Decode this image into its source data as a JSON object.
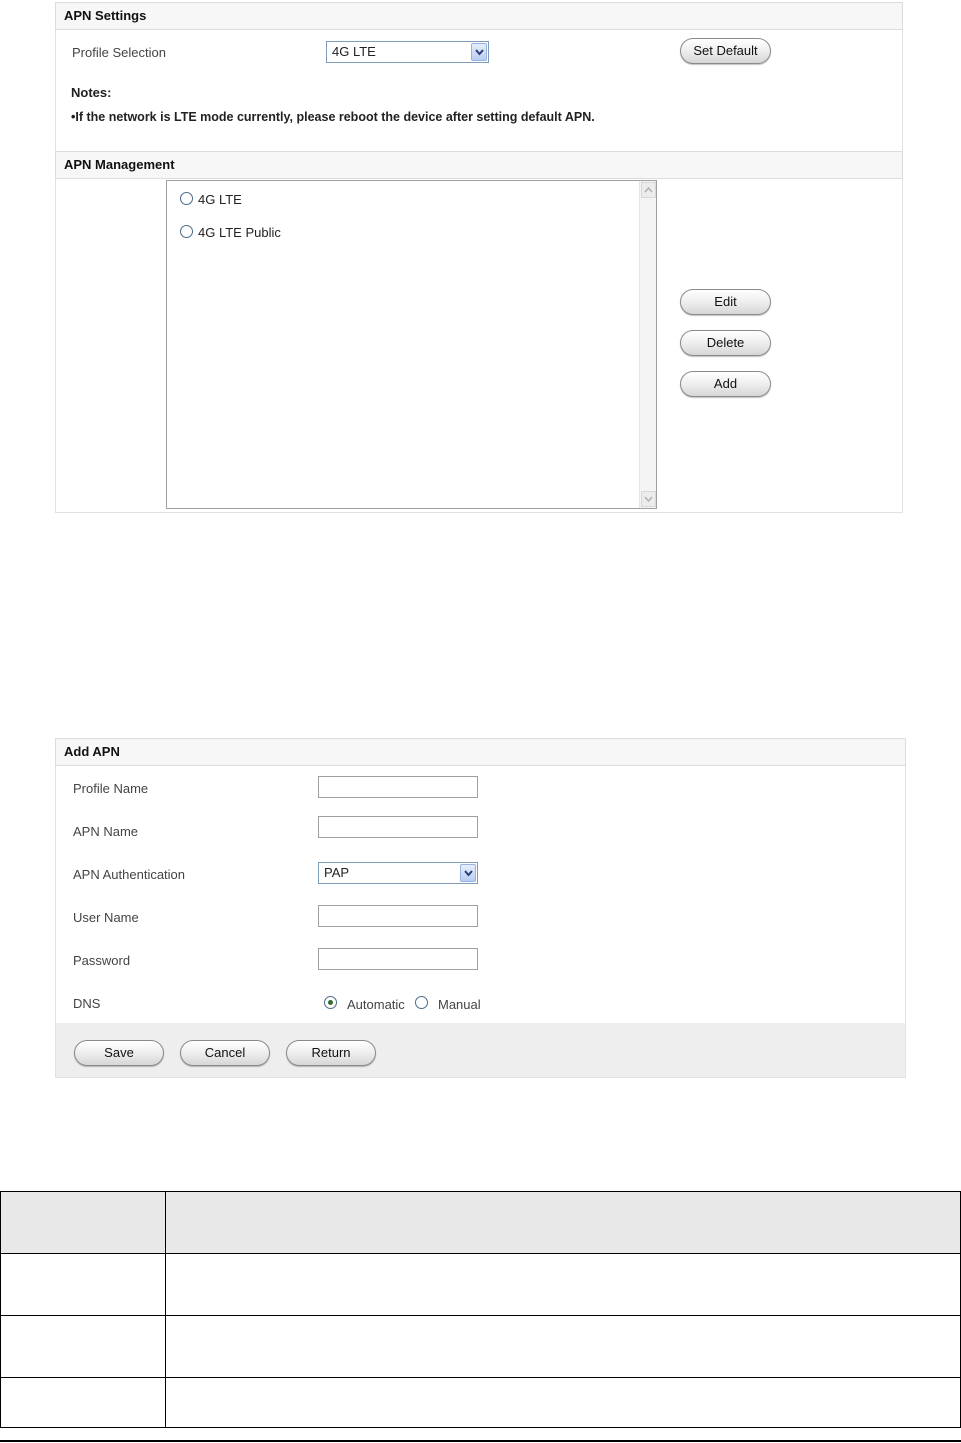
{
  "apn_settings": {
    "header": "APN Settings",
    "profile_selection_label": "Profile Selection",
    "profile_selection_value": "4G LTE",
    "set_default_label": "Set Default",
    "notes_title": "Notes:",
    "notes_text": "•If the network is LTE mode currently, please reboot the device after setting default APN."
  },
  "apn_management": {
    "header": "APN Management",
    "profiles": [
      {
        "label": "4G LTE",
        "checked": false
      },
      {
        "label": "4G LTE Public",
        "checked": false
      }
    ],
    "edit_label": "Edit",
    "delete_label": "Delete",
    "add_label": "Add"
  },
  "add_apn": {
    "header": "Add APN",
    "profile_name_label": "Profile Name",
    "profile_name_value": "",
    "apn_name_label": "APN Name",
    "apn_name_value": "",
    "apn_auth_label": "APN Authentication",
    "apn_auth_value": "PAP",
    "user_name_label": "User Name",
    "user_name_value": "",
    "password_label": "Password",
    "password_value": "",
    "dns_label": "DNS",
    "dns_options": [
      {
        "label": "Automatic",
        "checked": true
      },
      {
        "label": "Manual",
        "checked": false
      }
    ],
    "save_label": "Save",
    "cancel_label": "Cancel",
    "return_label": "Return"
  },
  "colors": {
    "header_bg": "#f7f7f7",
    "footer_bar_bg": "#eeeeee",
    "select_border": "#7f9db9"
  }
}
